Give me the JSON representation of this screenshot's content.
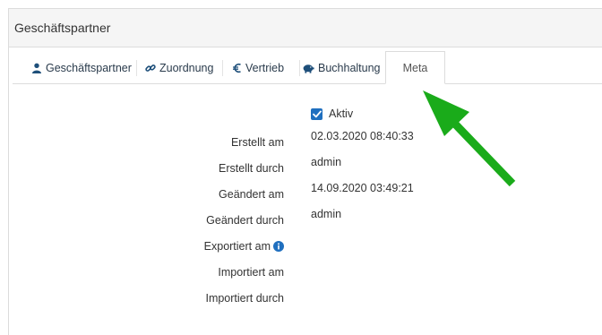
{
  "panel": {
    "title": "Geschäftspartner"
  },
  "tabs": [
    {
      "label": "Geschäftspartner",
      "icon": "user-icon"
    },
    {
      "label": "Zuordnung",
      "icon": "link-icon"
    },
    {
      "label": "Vertrieb",
      "icon": "euro-icon"
    },
    {
      "label": "Buchhaltung",
      "icon": "piggy-bank-icon"
    },
    {
      "label": "Meta",
      "icon": ""
    }
  ],
  "active_tab": "Meta",
  "meta": {
    "aktiv_label": "Aktiv",
    "aktiv_checked": true,
    "fields": [
      {
        "label": "Erstellt am",
        "value": "02.03.2020 08:40:33"
      },
      {
        "label": "Erstellt durch",
        "value": "admin"
      },
      {
        "label": "Geändert am",
        "value": "14.09.2020 03:49:21"
      },
      {
        "label": "Geändert durch",
        "value": "admin"
      },
      {
        "label": "Exportiert am",
        "value": ""
      },
      {
        "label": "Importiert am",
        "value": ""
      },
      {
        "label": "Importiert durch",
        "value": ""
      }
    ]
  },
  "colors": {
    "accent": "#1f6fbf",
    "arrow": "#1aab1a",
    "tab_text": "#2a3b4c"
  }
}
